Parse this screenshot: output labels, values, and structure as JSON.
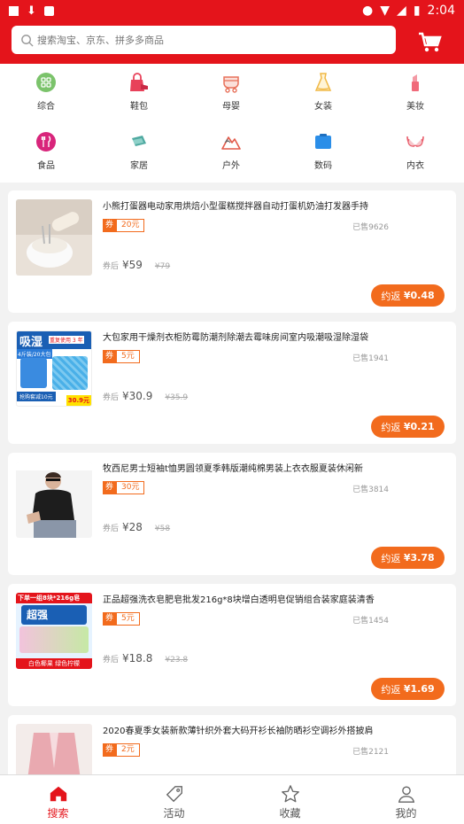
{
  "status": {
    "time": "2:04"
  },
  "search": {
    "placeholder": "搜索淘宝、京东、拼多多商品"
  },
  "categories": [
    {
      "label": "综合",
      "icon": "grid-icon",
      "color": "#7bc36b"
    },
    {
      "label": "鞋包",
      "icon": "bag-icon",
      "color": "#e8415a"
    },
    {
      "label": "母婴",
      "icon": "stroller-icon",
      "color": "#e8715a"
    },
    {
      "label": "女装",
      "icon": "dress-icon",
      "color": "#f0b845"
    },
    {
      "label": "美妆",
      "icon": "lipstick-icon",
      "color": "#f06a7a"
    },
    {
      "label": "食品",
      "icon": "fork-knife-icon",
      "color": "#d8257b"
    },
    {
      "label": "家居",
      "icon": "sofa-icon",
      "color": "#4ea9a0"
    },
    {
      "label": "户外",
      "icon": "mountain-icon",
      "color": "#e35a4a"
    },
    {
      "label": "数码",
      "icon": "device-icon",
      "color": "#2b8ee8"
    },
    {
      "label": "内衣",
      "icon": "bra-icon",
      "color": "#e85c6a"
    }
  ],
  "products": [
    {
      "title": "小熊打蛋器电动家用烘焙小型蛋糕搅拌器自动打蛋机奶油打发器手持",
      "coupon_label": "券",
      "coupon": "20元",
      "sold": "已售9626",
      "price_prefix": "券后",
      "price": "¥59",
      "original_price": "¥79",
      "rebate_label": "约返",
      "rebate": "¥0.48"
    },
    {
      "title": "大包家用干燥剂衣柜防霉防潮剂除潮去霉味房间室内吸潮吸湿除湿袋",
      "coupon_label": "券",
      "coupon": "5元",
      "sold": "已售1941",
      "price_prefix": "券后",
      "price": "¥30.9",
      "original_price": "¥35.9",
      "rebate_label": "约返",
      "rebate": "¥0.21",
      "thumb_text": [
        "吸湿",
        "重复使用 3 年",
        "4斤装/20大包",
        "抢购套减10元",
        "30.9元"
      ]
    },
    {
      "title": "牧西尼男士短袖t恤男圆领夏季韩版潮纯棉男装上衣衣服夏装休闲新",
      "coupon_label": "券",
      "coupon": "30元",
      "sold": "已售3814",
      "price_prefix": "券后",
      "price": "¥28",
      "original_price": "¥58",
      "rebate_label": "约返",
      "rebate": "¥3.78"
    },
    {
      "title": "正品超强洗衣皂肥皂批发216g*8块增白透明皂促销组合装家庭装清香",
      "coupon_label": "券",
      "coupon": "5元",
      "sold": "已售1454",
      "price_prefix": "券后",
      "price": "¥18.8",
      "original_price": "¥23.8",
      "rebate_label": "约返",
      "rebate": "¥1.69",
      "thumb_text": [
        "下单一组8块*216g皂",
        "超强",
        "白色椰果  绿色柠檬"
      ]
    },
    {
      "title": "2020春夏季女装新款薄针织外套大码开衫长袖防晒衫空调衫外搭披肩",
      "coupon_label": "券",
      "coupon": "2元",
      "sold": "已售2121"
    }
  ],
  "nav": [
    {
      "label": "搜索",
      "icon": "home-icon",
      "active": true
    },
    {
      "label": "活动",
      "icon": "tag-icon"
    },
    {
      "label": "收藏",
      "icon": "star-icon"
    },
    {
      "label": "我的",
      "icon": "user-icon"
    }
  ],
  "colors": {
    "brand": "#e4141b",
    "accent": "#f26b1d"
  }
}
